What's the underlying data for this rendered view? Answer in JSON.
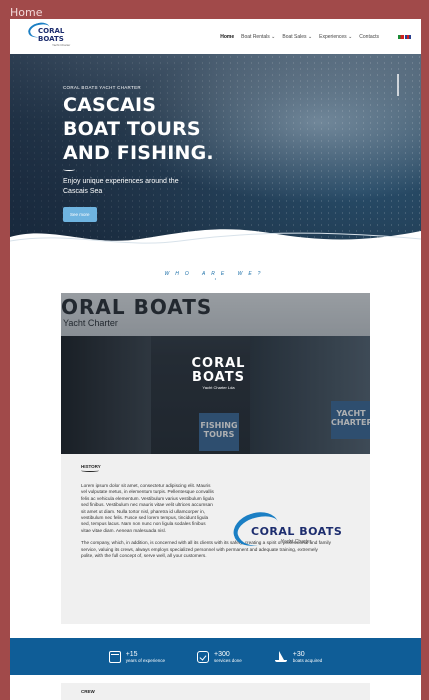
{
  "frame": {
    "label": "Home"
  },
  "header": {
    "logo_text": "CORAL BOATS",
    "logo_sub": "Yacht Charter",
    "nav": [
      {
        "label": "Home",
        "dropdown": false
      },
      {
        "label": "Boat Rentals",
        "dropdown": true
      },
      {
        "label": "Boat Sales",
        "dropdown": true
      },
      {
        "label": "Experiences",
        "dropdown": true
      },
      {
        "label": "Contacts",
        "dropdown": false
      }
    ],
    "chevron": "⌄"
  },
  "hero": {
    "kicker": "CORAL BOATS YACHT CHARTER",
    "title_lines": [
      "CASCAIS",
      "BOAT TOURS",
      "AND FISHING."
    ],
    "subtitle": "Enjoy unique experiences around the Cascais Sea",
    "button": "See more"
  },
  "who": {
    "heading": "WHO ARE WE?"
  },
  "store": {
    "sign": "ORAL BOATS",
    "sign_sub": "Yacht Charter",
    "brand_line1": "CORAL",
    "brand_line2": "BOATS",
    "brand_sub": "Yacht Charter Lda",
    "poster_left": "FISHING TOURS",
    "poster_right": "YACHT CHARTER"
  },
  "history": {
    "label": "HISTORY",
    "text": "Lorem ipsum dolor sit amet, consectetur adipiscing elit. Mauris vel vulputate metus, in elementum turpis. Pellentesque convallis felis ac vehicula elementum. Vestibulum varius vestibulum ligula sed finibus. Vestibulum nec mauris vitae velit ultrices accumsan sit amet ut diam. Nulla tortor nisl, pharetra id ullamcorper in, vestibulum nec felis. Fusce sed lorem tempus, tincidunt ligula sed, tempus lacus. Nam non nunc non ligula sodales finibus vitae vitae diam. Aenean malesuada nisl.",
    "text2": "The company, which, in addition, is concerned with all its clients with its safety, creating a spirit of professional and family service, valuing its crews, always employs specialized personnel with permanent and adequate training, extremely polite, with the full concept of, serve well, all your customers.",
    "logo_text": "CORAL BOATS",
    "logo_sub": "Yacht Charter"
  },
  "stats": [
    {
      "icon": "calendar-icon",
      "value": "+15",
      "label": "years of experience"
    },
    {
      "icon": "checklist-icon",
      "value": "+300",
      "label": "services done"
    },
    {
      "icon": "sailboat-icon",
      "value": "+30",
      "label": "boats acquired"
    }
  ],
  "crew": {
    "label": "CREW"
  }
}
